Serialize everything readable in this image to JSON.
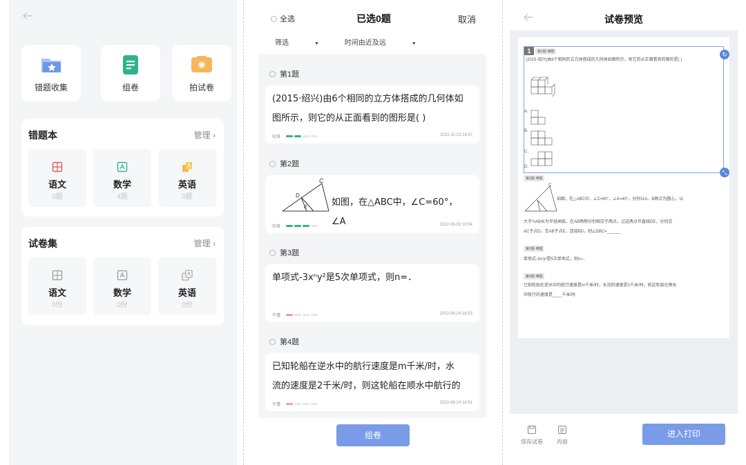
{
  "colors": {
    "accent": "#7a9ce8",
    "level_green": "#2fb489",
    "level_red": "#ef9e9e",
    "bar_empty": "#e6e6e9"
  },
  "panel1": {
    "back_icon": "arrow-left-icon",
    "tiles": [
      {
        "label": "错题收集",
        "icon": "folder-star-icon"
      },
      {
        "label": "组卷",
        "icon": "document-icon"
      },
      {
        "label": "拍试卷",
        "icon": "camera-icon"
      }
    ],
    "mistakes": {
      "title": "错题本",
      "manage": "管理 ›",
      "subjects": [
        {
          "name": "语文",
          "count": "0题",
          "icon": "grid-icon"
        },
        {
          "name": "数学",
          "count": "4题",
          "icon": "math-icon"
        },
        {
          "name": "英语",
          "count": "0题",
          "icon": "abc-icon"
        }
      ]
    },
    "papers": {
      "title": "试卷集",
      "manage": "管理 ›",
      "subjects": [
        {
          "name": "语文",
          "count": "0份",
          "icon": "grid-icon"
        },
        {
          "name": "数学",
          "count": "0份",
          "icon": "math-icon"
        },
        {
          "name": "英语",
          "count": "0份",
          "icon": "abc-icon"
        }
      ]
    }
  },
  "panel2": {
    "select_all": "全选",
    "title": "已选0题",
    "cancel": "取消",
    "filter": "筛选",
    "sort": "时间由近及远",
    "questions": [
      {
        "label": "第1题",
        "line1": "(2015·绍兴)由6个相同的立方体搭成的几何体如",
        "line2": "图所示，则它的从正面看到的图形是(      )",
        "level_text": "较难",
        "level": 2,
        "level_color": "green",
        "date": "2022-11-23 14:47"
      },
      {
        "label": "第2题",
        "line1": "如图，在△ABC中，∠C=60°，∠A",
        "line2": "",
        "level_text": "较难",
        "level": 3,
        "level_color": "green",
        "date": "2022-09-02 18:04"
      },
      {
        "label": "第3题",
        "line1": "单项式-3xⁿy²是5次单项式，则n=．",
        "line2": "",
        "level_text": "不懂",
        "level": 1,
        "level_color": "red",
        "date": "2022-08-24 16:53"
      },
      {
        "label": "第4题",
        "line1": "已知轮船在逆水中的航行速度是m千米/时，水",
        "line2": "流的速度是2千米/时，则这轮船在顺水中航行的",
        "level_text": "不懂",
        "level": 1,
        "level_color": "red",
        "date": "2022-08-24 16:51"
      }
    ],
    "compose_button": "组卷"
  },
  "panel3": {
    "title": "试卷预览",
    "selected_index": "1",
    "items": [
      {
        "tag": "第1题·难题",
        "text": "(2015·绍兴)由6个相同的立方体搭成的几何体如图所示，则它的从正面看到的图形是(      )",
        "options": [
          "A.",
          "B.",
          "C.",
          "D."
        ]
      },
      {
        "tag": "第2题·难题",
        "text1": "如图，在△ABC中，∠C=60°，∠A=40°，分别以A、B两点为圆心，以",
        "text2": "大于½AB长为半径画弧，在AB两侧分别相交于两点，过这两点作直线DE，分别交",
        "text3": "AC于点D，交AB于点E，连接BD，则∠DBC=______"
      },
      {
        "tag": "第3题·难题",
        "text": "单项式-3xⁿy²是5次单项式，则n=．"
      },
      {
        "tag": "第4题·难题",
        "text1": "已知轮船在逆水中的航行速度是m千米/时，水流的速度是2千米/时，则这轮船在顺水",
        "text2": "中航行的速度是____千米/时."
      }
    ],
    "save_label": "保存试卷",
    "content_label": "内容",
    "print_button": "进入打印"
  }
}
